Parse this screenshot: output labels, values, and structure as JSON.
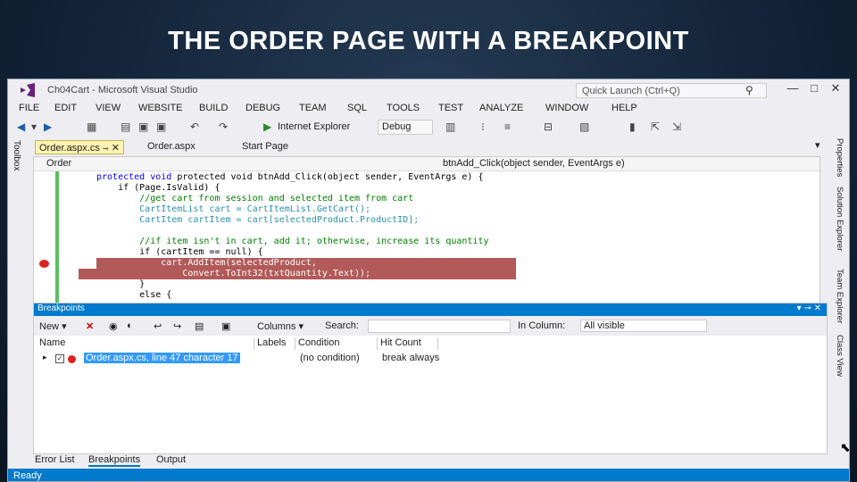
{
  "slide": {
    "title": "THE ORDER PAGE WITH A BREAKPOINT"
  },
  "window": {
    "title": "Ch04Cart - Microsoft Visual Studio",
    "quick_launch": "Quick Launch (Ctrl+Q)",
    "buttons": [
      "—",
      "□",
      "✕"
    ]
  },
  "menu": [
    "FILE",
    "EDIT",
    "VIEW",
    "WEBSITE",
    "BUILD",
    "DEBUG",
    "TEAM",
    "SQL",
    "TOOLS",
    "TEST",
    "ANALYZE",
    "WINDOW",
    "HELP"
  ],
  "toolbar": {
    "browser": "Internet Explorer",
    "config": "Debug"
  },
  "toolbox_label": "Toolbox",
  "tabs": [
    {
      "label": "Order.aspx.cs",
      "active": true
    },
    {
      "label": "Order.aspx",
      "active": false
    },
    {
      "label": "Start Page",
      "active": false
    }
  ],
  "editor": {
    "nav_left": "Order",
    "nav_right": "btnAdd_Click(object sender, EventArgs e)",
    "lines": [
      "protected void btnAdd_Click(object sender, EventArgs e) {",
      "    if (Page.IsValid) {",
      "        //get cart from session and selected item from cart",
      "        CartItemList cart = CartItemList.GetCart();",
      "        CartItem cartItem = cart[selectedProduct.ProductID];",
      "",
      "        //if item isn't in cart, add it; otherwise, increase its quantity",
      "        if (cartItem == null) {",
      "            cart.AddItem(selectedProduct,",
      "                Convert.ToInt32(txtQuantity.Text));",
      "        }",
      "        else {"
    ]
  },
  "right_labels": [
    "Properties",
    "Solution Explorer",
    "Team Explorer",
    "Class View"
  ],
  "breakpoints_panel": {
    "title": "Breakpoints",
    "toolbar": {
      "new": "New",
      "columns": "Columns",
      "search": "Search:",
      "in_column": "In Column:",
      "in_column_value": "All visible"
    },
    "columns": [
      "Name",
      "Labels",
      "Condition",
      "Hit Count"
    ],
    "rows": [
      {
        "name": "Order.aspx.cs, line 47 character 17",
        "labels": "",
        "condition": "(no condition)",
        "hit_count": "break always"
      }
    ]
  },
  "bottom_tabs": [
    {
      "label": "Error List",
      "active": false
    },
    {
      "label": "Breakpoints",
      "active": true
    },
    {
      "label": "Output",
      "active": false
    }
  ],
  "status": "Ready",
  "colors": {
    "accent": "#007acc",
    "breakpoint": "#dd2222",
    "highlight": "#b25a5a"
  }
}
